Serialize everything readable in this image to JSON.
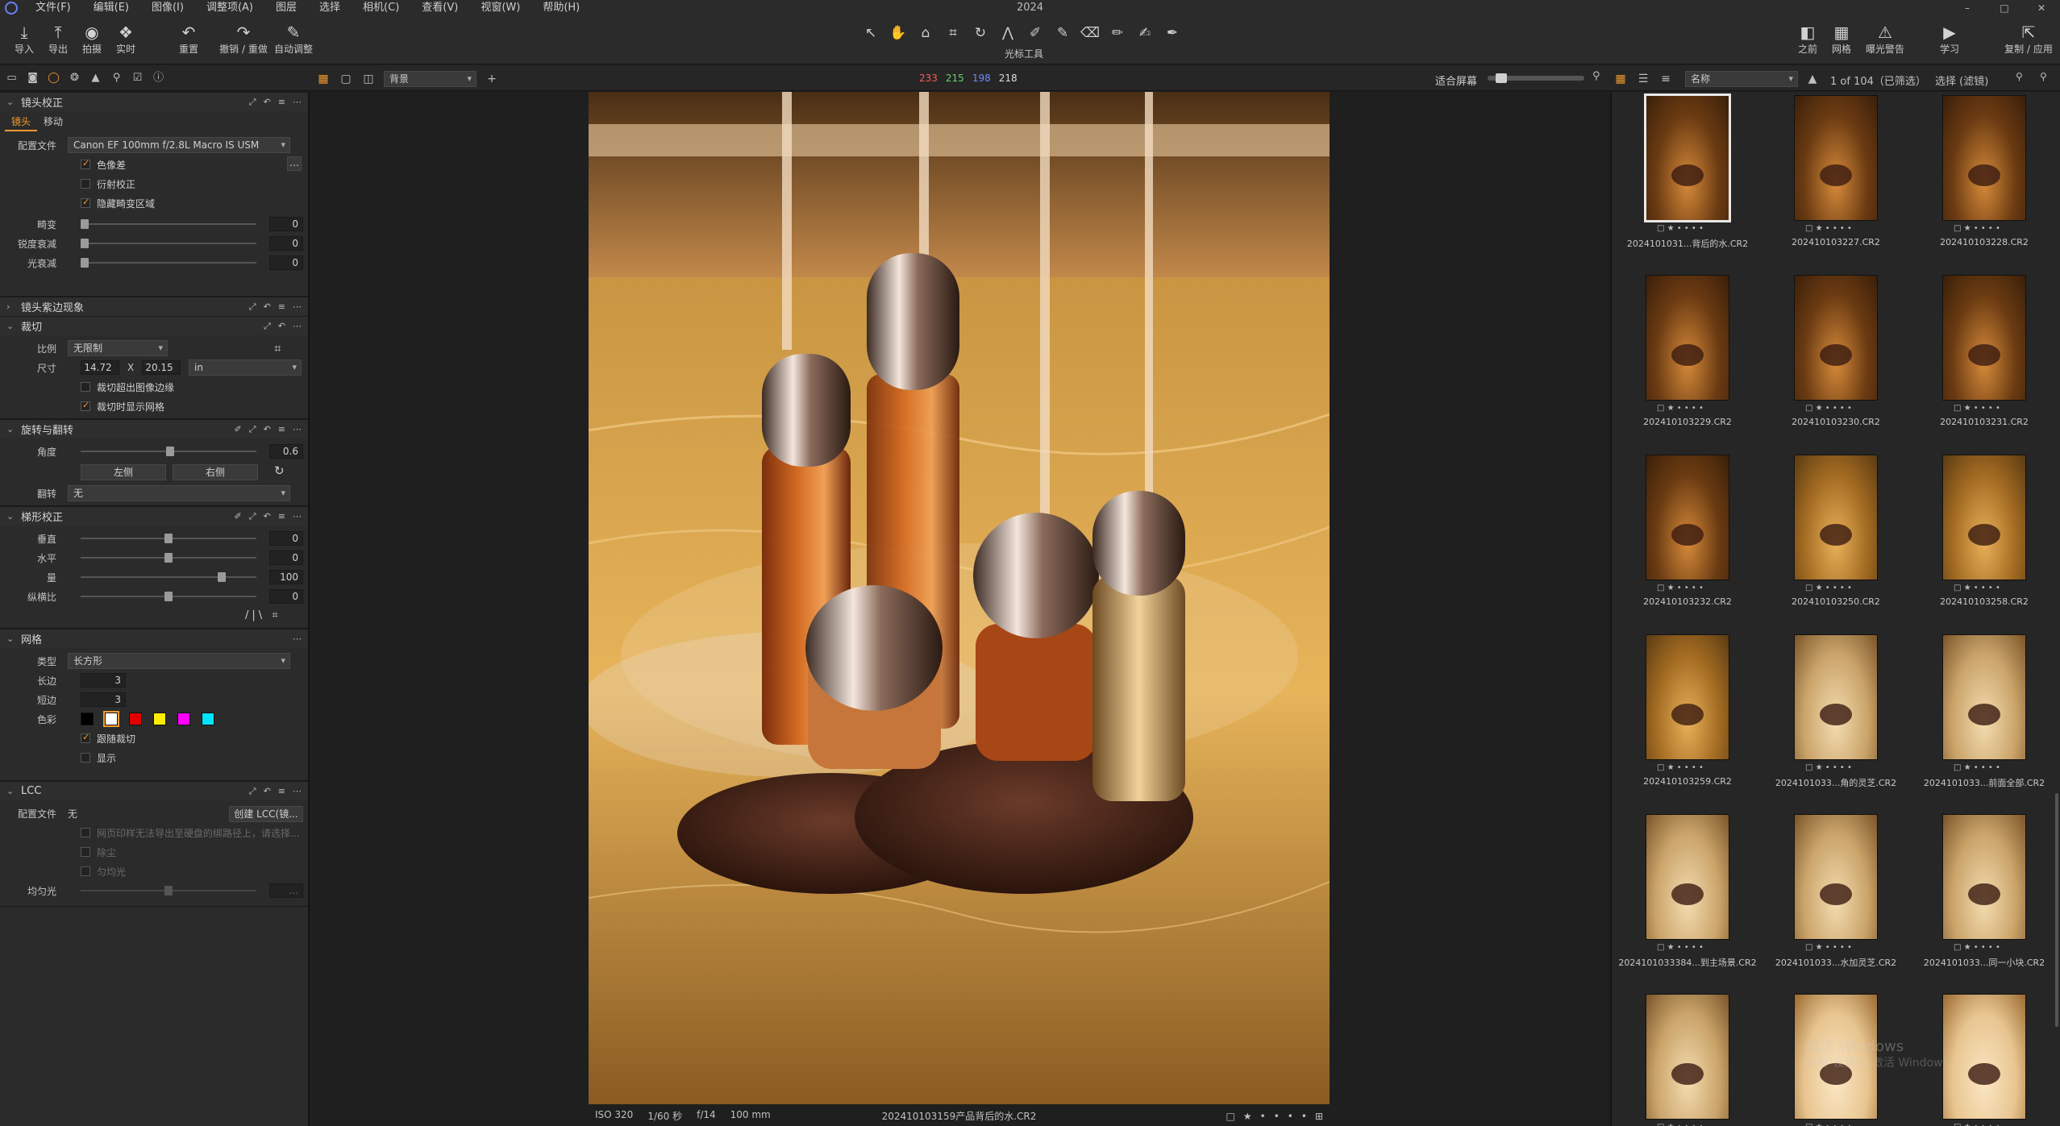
{
  "window": {
    "title": "2024",
    "controls": [
      "–",
      "□",
      "✕"
    ]
  },
  "menu": [
    "文件(F)",
    "编辑(E)",
    "图像(I)",
    "调整项(A)",
    "图层",
    "选择",
    "相机(C)",
    "查看(V)",
    "视窗(W)",
    "帮助(H)"
  ],
  "toolbar": {
    "left": [
      {
        "icon": "⤓",
        "label": "导入"
      },
      {
        "icon": "⤒",
        "label": "导出"
      },
      {
        "icon": "◉",
        "label": "拍摄"
      },
      {
        "icon": "❖",
        "label": "实时"
      },
      {
        "icon": "↶",
        "label": "重置"
      },
      {
        "icon": "↷",
        "label": "撤销 / 重做"
      },
      {
        "icon": "✎",
        "label": "自动调整"
      }
    ],
    "cursor_tools_label": "光标工具",
    "right": [
      {
        "icon": "◧",
        "label": "之前"
      },
      {
        "icon": "▦",
        "label": "网格"
      },
      {
        "icon": "⚠",
        "label": "曝光警告"
      },
      {
        "icon": "▶",
        "label": "学习"
      },
      {
        "icon": "⇱",
        "label": "复制 / 应用"
      }
    ]
  },
  "subbar": {
    "viewer_select": "背景",
    "rgb": {
      "r": "233",
      "g": "215",
      "b": "198",
      "k": "218"
    },
    "fit": "适合屏幕",
    "sort_select": "名称",
    "count": "1 of 104（已筛选）",
    "selection": "选择 (滤镜)"
  },
  "left_panel": {
    "lens": {
      "title": "镜头校正",
      "tabs": [
        "镜头",
        "移动"
      ],
      "profile_label": "配置文件",
      "profile_value": "Canon EF 100mm f/2.8L Macro IS USM",
      "checks": [
        {
          "label": "色像差",
          "on": true
        },
        {
          "label": "衍射校正",
          "on": false
        },
        {
          "label": "隐藏畸变区域",
          "on": true
        }
      ],
      "sliders": [
        {
          "label": "畸变",
          "value": "0"
        },
        {
          "label": "锐度衰减",
          "value": "0"
        },
        {
          "label": "光衰减",
          "value": "0"
        }
      ]
    },
    "purple": {
      "title": "镜头紫边现象"
    },
    "crop": {
      "title": "裁切",
      "ratio_label": "比例",
      "ratio_value": "无限制",
      "size_label": "尺寸",
      "w": "14.72",
      "x": "X",
      "h": "20.15",
      "unit": "in",
      "checks": [
        {
          "label": "裁切超出图像边缘",
          "on": false
        },
        {
          "label": "裁切时显示网格",
          "on": true
        }
      ]
    },
    "rotate": {
      "title": "旋转与翻转",
      "angle_label": "角度",
      "angle_value": "0.6",
      "left_btn": "左侧",
      "right_btn": "右侧",
      "flip_label": "翻转",
      "flip_value": "无"
    },
    "keystone": {
      "title": "梯形校正",
      "sliders": [
        {
          "label": "垂直",
          "value": "0",
          "pos": 0.5
        },
        {
          "label": "水平",
          "value": "0",
          "pos": 0.5
        },
        {
          "label": "量",
          "value": "100",
          "pos": 0.8
        },
        {
          "label": "纵横比",
          "value": "0",
          "pos": 0.5
        }
      ],
      "icons": "/|\\  ⌗"
    },
    "grid": {
      "title": "网格",
      "type_label": "类型",
      "type_value": "长方形",
      "long_label": "长边",
      "long_value": "3",
      "short_label": "短边",
      "short_value": "3",
      "color_label": "色彩",
      "colors": [
        "#000000",
        "#ffffff",
        "#e00000",
        "#ffee00",
        "#ff00ff",
        "#00e5ff"
      ],
      "checks": [
        {
          "label": "跟随裁切",
          "on": true
        },
        {
          "label": "显示",
          "on": false
        }
      ]
    },
    "lcc": {
      "title": "LCC",
      "profile_label": "配置文件",
      "profile_value": "无",
      "create_btn": "创建 LCC(镜...",
      "checks": [
        {
          "label": "网页印样无法导出至硬盘的绑路径上，请选择...",
          "on": false
        },
        {
          "label": "除尘",
          "on": false
        },
        {
          "label": "匀均光",
          "on": false
        }
      ],
      "uniform_label": "均匀光"
    }
  },
  "viewer": {
    "meta": [
      "ISO 320",
      "1/60 秒",
      "f/14",
      "100 mm"
    ],
    "filename": "202410103159产品背后的水.CR2",
    "rating": [
      "□",
      "★",
      "•",
      "•",
      "•",
      "•",
      "⊞"
    ]
  },
  "browser": {
    "thumbs": [
      {
        "name": "2024101031...背后的水.CR2",
        "tone": "amber",
        "selected": true
      },
      {
        "name": "202410103227.CR2",
        "tone": "amber"
      },
      {
        "name": "202410103228.CR2",
        "tone": "amber"
      },
      {
        "name": "202410103229.CR2",
        "tone": "amber"
      },
      {
        "name": "202410103230.CR2",
        "tone": "amber"
      },
      {
        "name": "202410103231.CR2",
        "tone": "amber"
      },
      {
        "name": "202410103232.CR2",
        "tone": "amber"
      },
      {
        "name": "202410103250.CR2",
        "tone": "gold"
      },
      {
        "name": "202410103258.CR2",
        "tone": "gold"
      },
      {
        "name": "202410103259.CR2",
        "tone": "gold"
      },
      {
        "name": "2024101033...角的灵芝.CR2",
        "tone": "cream"
      },
      {
        "name": "2024101033...前面全部.CR2",
        "tone": "cream"
      },
      {
        "name": "2024101033384...到主场景.CR2",
        "tone": "cream"
      },
      {
        "name": "2024101033...水加灵芝.CR2",
        "tone": "cream"
      },
      {
        "name": "2024101033...同一小块.CR2",
        "tone": "cream"
      },
      {
        "name": "",
        "tone": "cream"
      },
      {
        "name": "",
        "tone": "bright"
      },
      {
        "name": "",
        "tone": "bright"
      }
    ],
    "watermark": "激活 Windows",
    "watermark2": "转到\"设置\"以激活 Windows。"
  }
}
